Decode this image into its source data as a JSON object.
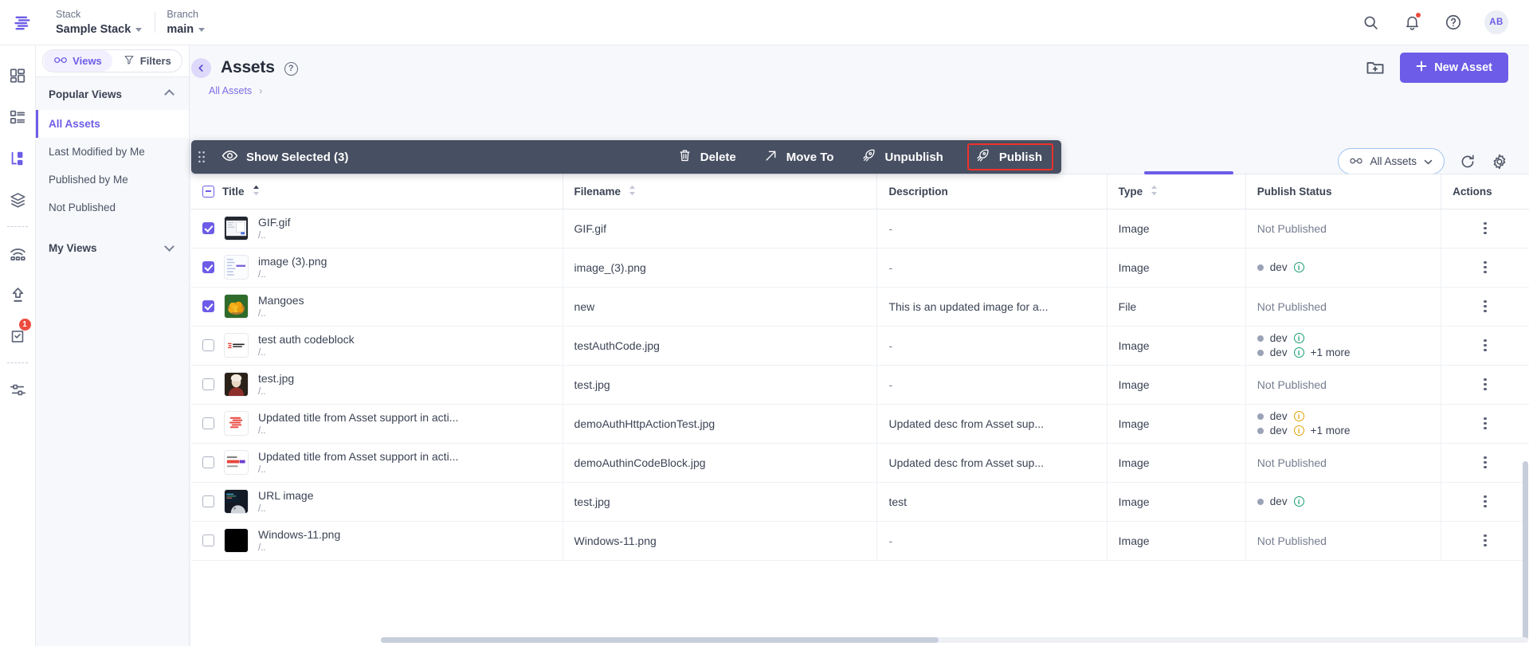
{
  "topbar": {
    "logo_icon": "contentstack-logo-icon",
    "stack": {
      "label": "Stack",
      "value": "Sample Stack"
    },
    "branch": {
      "label": "Branch",
      "value": "main"
    },
    "icons": [
      "search-icon",
      "notification-bell-icon",
      "help-circle-icon"
    ],
    "avatar_initials": "AB"
  },
  "rail": {
    "items": [
      {
        "icon": "dashboard-grid-icon",
        "name": "dashboard"
      },
      {
        "icon": "content-types-list-icon",
        "name": "content-types"
      },
      {
        "icon": "entries-branch-icon",
        "name": "entries"
      },
      {
        "icon": "assets-stack-layers-icon",
        "name": "assets"
      },
      {
        "icon": "live-preview-wifi-icon",
        "name": "live-preview"
      },
      {
        "icon": "publish-upload-arrow-icon",
        "name": "releases"
      },
      {
        "icon": "tasks-clipboard-check-icon",
        "name": "tasks",
        "badge": "1"
      },
      {
        "icon": "settings-sliders-icon",
        "name": "settings"
      }
    ]
  },
  "views_panel": {
    "toggle": {
      "views_label": "Views",
      "views_icon": "views-glasses-icon",
      "filters_label": "Filters",
      "filters_icon": "filter-funnel-icon"
    },
    "sections": [
      {
        "title": "Popular Views",
        "collapse_icon": "chevron-up-icon",
        "items": [
          {
            "label": "All Assets",
            "active": true
          },
          {
            "label": "Last Modified by Me",
            "active": false
          },
          {
            "label": "Published by Me",
            "active": false
          },
          {
            "label": "Not Published",
            "active": false
          }
        ]
      },
      {
        "title": "My Views",
        "collapse_icon": "chevron-down-icon",
        "items": []
      }
    ]
  },
  "page": {
    "back_icon": "chevron-left-icon",
    "title": "Assets",
    "help_icon": "help-circle-icon",
    "breadcrumb": {
      "label": "All Assets",
      "separator": "›"
    },
    "new_folder_icon": "new-folder-icon",
    "new_asset_button": {
      "label": "New Asset",
      "icon": "plus-icon"
    }
  },
  "table_toolbar": {
    "view_select": {
      "label": "All Assets",
      "icon": "views-glasses-icon",
      "caret": "chevron-down-icon"
    },
    "refresh_icon": "refresh-icon",
    "settings_icon": "gear-icon"
  },
  "action_bar": {
    "drag_handle_icon": "drag-handle-dots-icon",
    "show_selected": {
      "label": "Show Selected (3)",
      "icon": "eye-icon"
    },
    "actions": [
      {
        "label": "Delete",
        "icon": "trash-icon",
        "highlighted": false
      },
      {
        "label": "Move To",
        "icon": "arrow-up-right-icon",
        "highlighted": false
      },
      {
        "label": "Unpublish",
        "icon": "unpublish-rocket-icon",
        "highlighted": false
      },
      {
        "label": "Publish",
        "icon": "publish-rocket-icon",
        "highlighted": true
      }
    ],
    "highlight_color": "#f0312b"
  },
  "table": {
    "columns": [
      {
        "label": "Title",
        "sortable": true,
        "sort": "asc"
      },
      {
        "label": "Filename",
        "sortable": true,
        "sort": "none"
      },
      {
        "label": "Description",
        "sortable": false,
        "sort": "none"
      },
      {
        "label": "Type",
        "sortable": true,
        "sort": "none"
      },
      {
        "label": "Publish Status",
        "sortable": false,
        "sort": "none"
      },
      {
        "label": "Actions",
        "sortable": false,
        "sort": "none"
      }
    ],
    "header_checkbox_state": "indeterminate",
    "rows": [
      {
        "selected": true,
        "title": "GIF.gif",
        "path": "/..",
        "thumb": "screenshot-thumb",
        "filename": "GIF.gif",
        "description": "-",
        "type": "Image",
        "status": {
          "kind": "not-published",
          "text": "Not Published"
        }
      },
      {
        "selected": true,
        "title": "image (3).png",
        "path": "/..",
        "thumb": "document-thumb",
        "filename": "image_(3).png",
        "description": "-",
        "type": "Image",
        "status": {
          "kind": "envs",
          "envs": [
            {
              "name": "dev",
              "info": "green",
              "more": ""
            }
          ]
        }
      },
      {
        "selected": true,
        "title": "Mangoes",
        "path": "/..",
        "thumb": "mangoes-thumb",
        "filename": "new",
        "description": "This is an updated image for a...",
        "type": "File",
        "status": {
          "kind": "not-published",
          "text": "Not Published"
        }
      },
      {
        "selected": false,
        "title": "test auth codeblock",
        "path": "/..",
        "thumb": "contentstack-logo-thumb",
        "filename": "testAuthCode.jpg",
        "description": "-",
        "type": "Image",
        "status": {
          "kind": "envs",
          "envs": [
            {
              "name": "dev",
              "info": "green",
              "more": ""
            },
            {
              "name": "dev",
              "info": "green",
              "more": "+1 more"
            }
          ]
        }
      },
      {
        "selected": false,
        "title": "test.jpg",
        "path": "/..",
        "thumb": "portrait-thumb",
        "filename": "test.jpg",
        "description": "-",
        "type": "Image",
        "status": {
          "kind": "not-published",
          "text": "Not Published"
        }
      },
      {
        "selected": false,
        "title": "Updated title from Asset support in acti...",
        "path": "/..",
        "thumb": "contentstack-mark-thumb",
        "filename": "demoAuthHttpActionTest.jpg",
        "description": "Updated desc from Asset sup...",
        "type": "Image",
        "status": {
          "kind": "envs",
          "envs": [
            {
              "name": "dev",
              "info": "amber",
              "more": ""
            },
            {
              "name": "dev",
              "info": "amber",
              "more": "+1 more"
            }
          ]
        }
      },
      {
        "selected": false,
        "title": "Updated title from Asset support in acti...",
        "path": "/..",
        "thumb": "contentcon-thumb",
        "filename": "demoAuthinCodeBlock.jpg",
        "description": "Updated desc from Asset sup...",
        "type": "Image",
        "status": {
          "kind": "not-published",
          "text": "Not Published"
        }
      },
      {
        "selected": false,
        "title": "URL image",
        "path": "/..",
        "thumb": "url-image-thumb",
        "filename": "test.jpg",
        "description": "test",
        "type": "Image",
        "status": {
          "kind": "envs",
          "envs": [
            {
              "name": "dev",
              "info": "green",
              "more": ""
            }
          ]
        }
      },
      {
        "selected": false,
        "title": "Windows-11.png",
        "path": "/..",
        "thumb": "dark-thumb",
        "filename": "Windows-11.png",
        "description": "-",
        "type": "Image",
        "status": {
          "kind": "not-published",
          "text": "Not Published"
        }
      }
    ],
    "row_menu_icon": "kebab-menu-icon"
  },
  "colors": {
    "accent": "#6c5ce7",
    "action_bar_bg": "#474f62",
    "highlight": "#f0312b",
    "published_dot": "#9aa2b6"
  }
}
